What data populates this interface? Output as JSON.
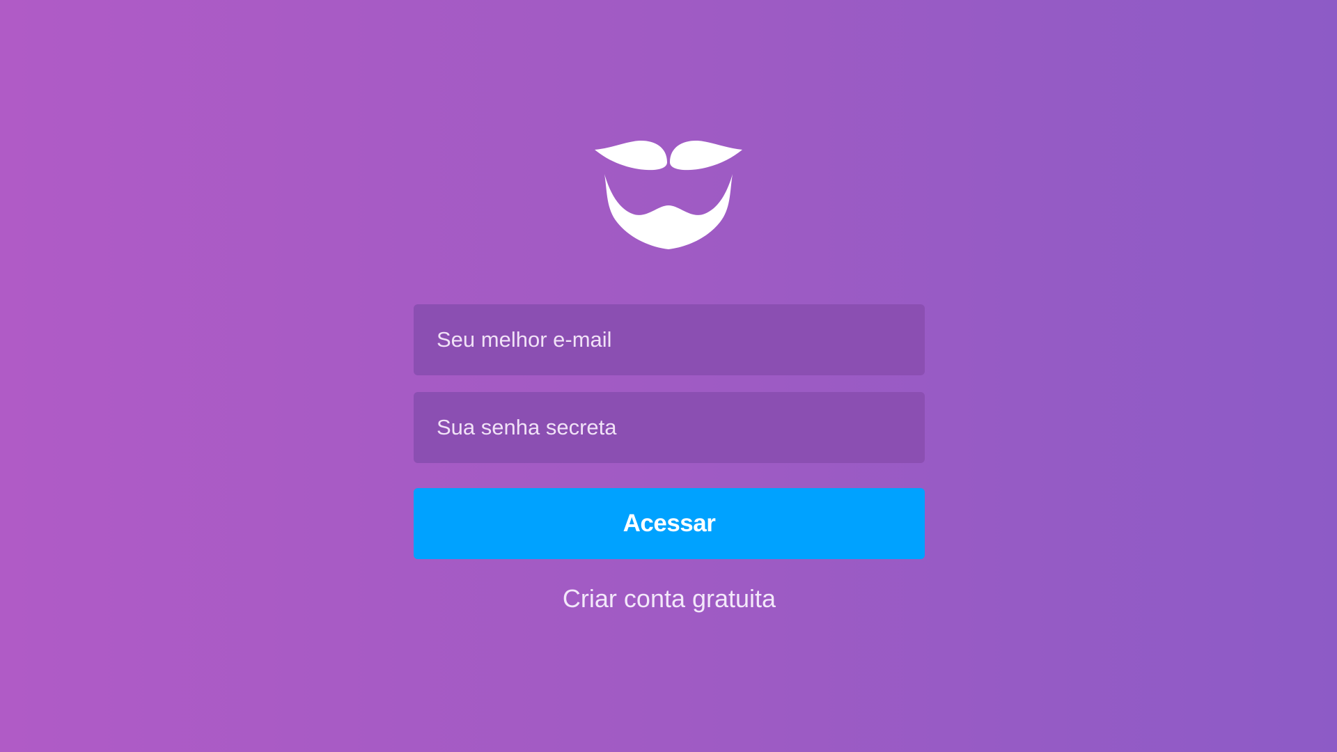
{
  "logo": {
    "icon": "mustache-beard-icon",
    "color": "#ffffff"
  },
  "login": {
    "email_placeholder": "Seu melhor e-mail",
    "password_placeholder": "Sua senha secreta",
    "submit_label": "Acessar",
    "create_account_label": "Criar conta gratuita"
  },
  "colors": {
    "background_left": "#b05bc6",
    "background_right": "#8d5bc6",
    "field_background": "#8b4fb2",
    "button_background": "#00a2ff"
  }
}
